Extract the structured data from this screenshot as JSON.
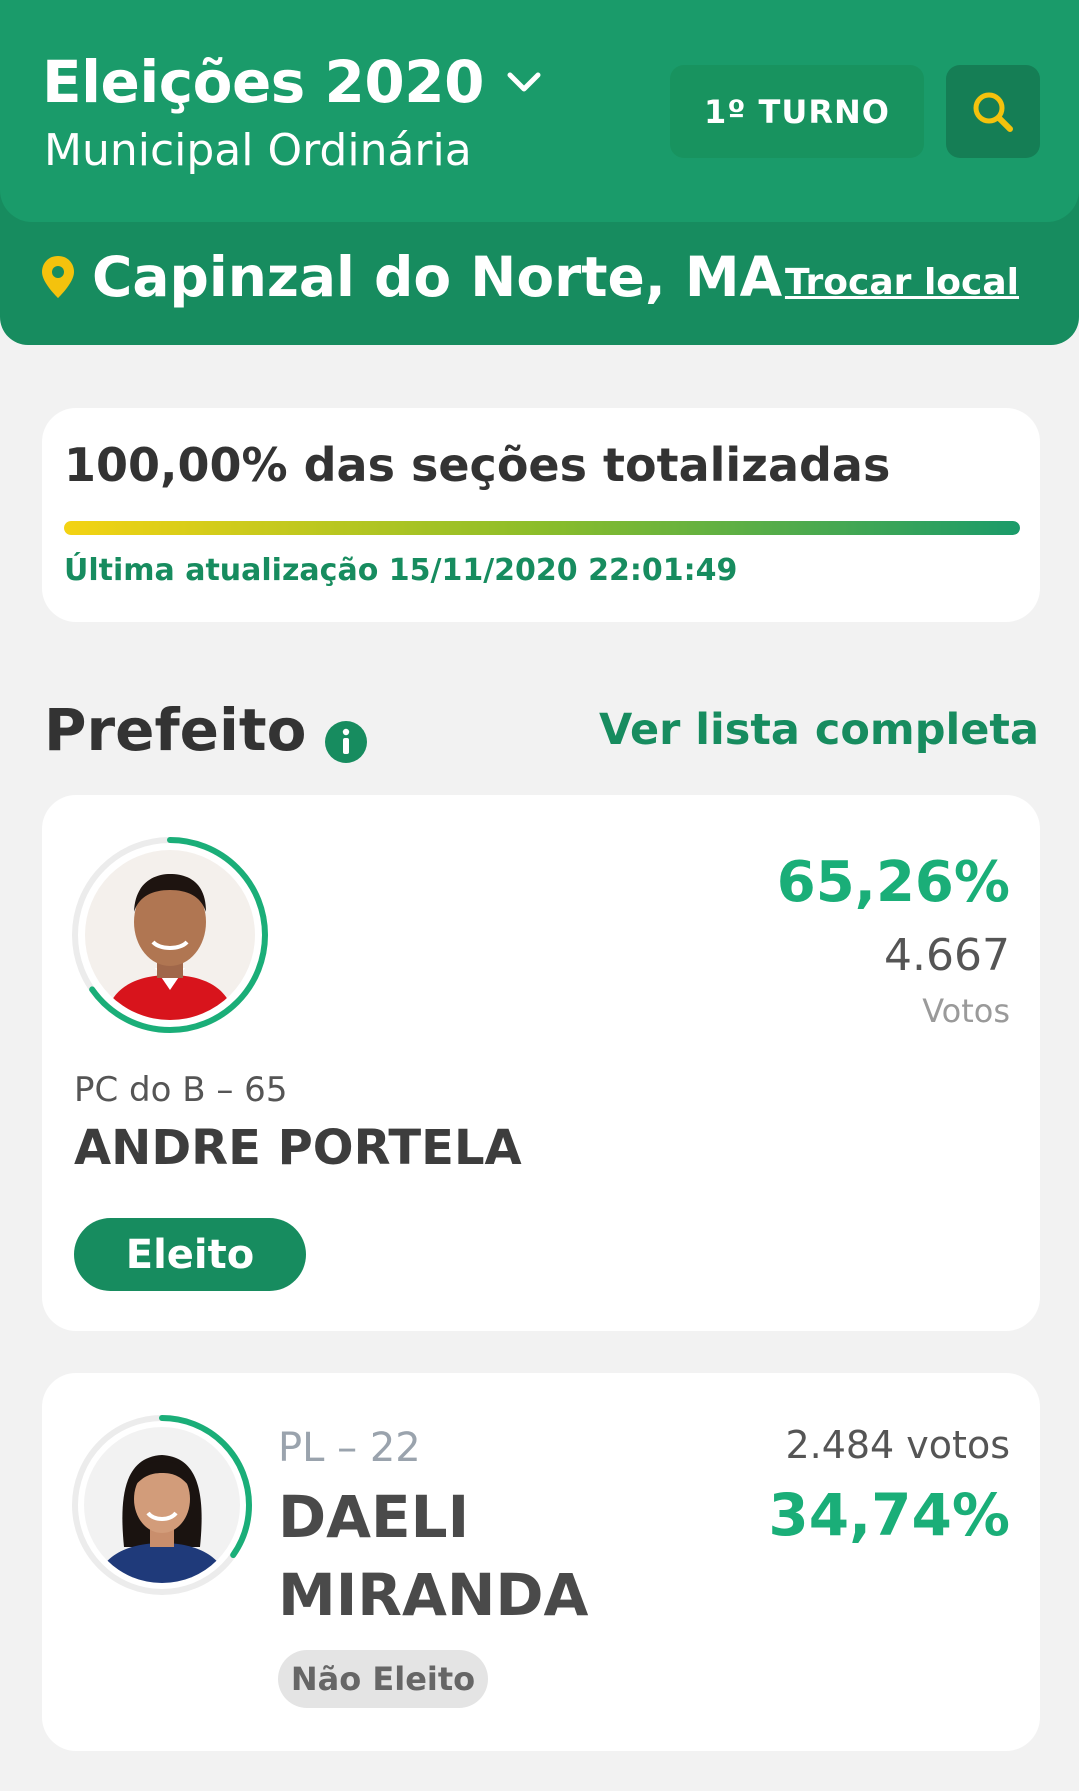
{
  "header": {
    "election_title": "Eleições 2020",
    "election_subtitle": "Municipal Ordinária",
    "turno_label": "1º TURNO",
    "location": "Capinzal do Norte, MA",
    "change_location_label": "Trocar local",
    "colors": {
      "primary": "#1a9b6a",
      "accent_icon": "#f4c20d"
    }
  },
  "progress": {
    "title": "100,00% das seções totalizadas",
    "percent": 100,
    "last_update": "Última atualização 15/11/2020 22:01:49"
  },
  "section": {
    "title": "Prefeito",
    "info_icon": "info-icon",
    "see_full_list": "Ver lista completa"
  },
  "candidates": [
    {
      "percent": "65,26%",
      "percent_value": 65.26,
      "votes": "4.667",
      "votes_label": "Votos",
      "party": "PC do B – 65",
      "name": "ANDRE PORTELA",
      "status": "Eleito"
    },
    {
      "percent": "34,74%",
      "percent_value": 34.74,
      "votes": "2.484 votos",
      "party": "PL – 22",
      "name": "DAELI MIRANDA",
      "status": "Não Eleito"
    }
  ]
}
